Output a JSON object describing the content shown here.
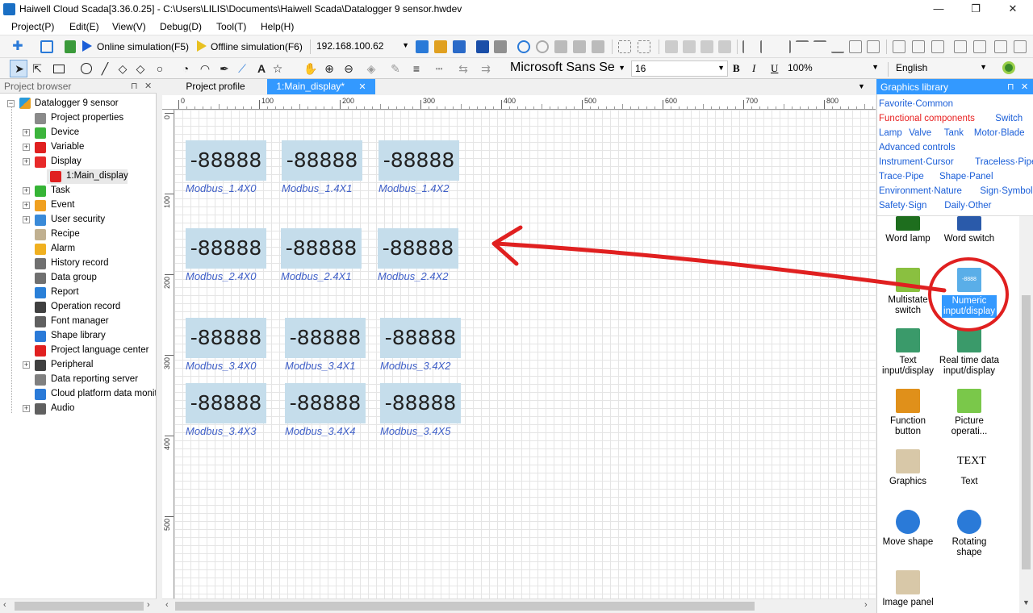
{
  "window": {
    "title": "Haiwell Cloud Scada[3.36.0.25] - C:\\Users\\LILIS\\Documents\\Haiwell Scada\\Datalogger 9 sensor.hwdev",
    "minimize": "—",
    "maximize": "❐",
    "close": "✕"
  },
  "menu": [
    "Project(P)",
    "Edit(E)",
    "View(V)",
    "Debug(D)",
    "Tool(T)",
    "Help(H)"
  ],
  "toolbar": {
    "online_sim": "Online simulation(F5)",
    "offline_sim": "Offline simulation(F6)",
    "ip": "192.168.100.62",
    "font_name": "Microsoft Sans Se",
    "font_size": "16",
    "bold": "B",
    "italic": "I",
    "underline": "U",
    "zoom": "100%",
    "language": "English",
    "text_tool": "A"
  },
  "project_browser": {
    "title": "Project browser",
    "pin": "⊓",
    "close": "✕",
    "root": "Datalogger 9 sensor",
    "items": [
      {
        "label": "Project properties",
        "icon": "properties-icon",
        "color": "#8a8a8a",
        "expandable": false
      },
      {
        "label": "Device",
        "icon": "device-icon",
        "color": "#3cb43c",
        "expandable": true
      },
      {
        "label": "Variable",
        "icon": "variable-icon",
        "color": "#e02020",
        "expandable": true
      },
      {
        "label": "Display",
        "icon": "display-icon",
        "color": "#e82a2a",
        "expandable": true
      },
      {
        "label": "1:Main_display",
        "icon": "star-page-icon",
        "color": "#e02020",
        "expandable": false
      },
      {
        "label": "Task",
        "icon": "task-icon",
        "color": "#36b436",
        "expandable": true
      },
      {
        "label": "Event",
        "icon": "event-icon",
        "color": "#f0a020",
        "expandable": true
      },
      {
        "label": "User security",
        "icon": "user-security-icon",
        "color": "#3a8ad8",
        "expandable": true
      },
      {
        "label": "Recipe",
        "icon": "recipe-icon",
        "color": "#c0b090",
        "expandable": false
      },
      {
        "label": "Alarm",
        "icon": "alarm-icon",
        "color": "#f0b020",
        "expandable": false
      },
      {
        "label": "History record",
        "icon": "history-icon",
        "color": "#707070",
        "expandable": false
      },
      {
        "label": "Data group",
        "icon": "data-group-icon",
        "color": "#707070",
        "expandable": false
      },
      {
        "label": "Report",
        "icon": "report-icon",
        "color": "#2a80d8",
        "expandable": false
      },
      {
        "label": "Operation record",
        "icon": "operation-record-icon",
        "color": "#404040",
        "expandable": false
      },
      {
        "label": "Font manager",
        "icon": "font-manager-icon",
        "color": "#606060",
        "expandable": false
      },
      {
        "label": "Shape library",
        "icon": "shape-library-icon",
        "color": "#2a7ad8",
        "expandable": false
      },
      {
        "label": "Project language center",
        "icon": "language-icon",
        "color": "#e02020",
        "expandable": false
      },
      {
        "label": "Peripheral",
        "icon": "peripheral-icon",
        "color": "#404040",
        "expandable": true
      },
      {
        "label": "Data reporting server",
        "icon": "reporting-server-icon",
        "color": "#808080",
        "expandable": false
      },
      {
        "label": "Cloud platform data monitor",
        "icon": "cloud-icon",
        "color": "#2a7ad8",
        "expandable": false
      },
      {
        "label": "Audio",
        "icon": "audio-icon",
        "color": "#606060",
        "expandable": true
      }
    ]
  },
  "tabs": [
    {
      "label": "Project profile",
      "active": false
    },
    {
      "label": "1:Main_display*",
      "active": true
    }
  ],
  "tab_close": "✕",
  "ruler": {
    "h_ticks": [
      "0",
      "100",
      "200",
      "300",
      "400",
      "500",
      "600",
      "700",
      "800"
    ],
    "v_ticks": [
      "0",
      "100",
      "200",
      "300",
      "400",
      "500"
    ]
  },
  "display_widgets": [
    {
      "value": "-88888",
      "label": "Modbus_1.4X0"
    },
    {
      "value": "-88888",
      "label": "Modbus_1.4X1"
    },
    {
      "value": "-88888",
      "label": "Modbus_1.4X2"
    },
    {
      "value": "-88888",
      "label": "Modbus_2.4X0"
    },
    {
      "value": "-88888",
      "label": "Modbus_2.4X1"
    },
    {
      "value": "-88888",
      "label": "Modbus_2.4X2"
    },
    {
      "value": "-88888",
      "label": "Modbus_3.4X0"
    },
    {
      "value": "-88888",
      "label": "Modbus_3.4X1"
    },
    {
      "value": "-88888",
      "label": "Modbus_3.4X2"
    },
    {
      "value": "-88888",
      "label": "Modbus_3.4X3"
    },
    {
      "value": "-88888",
      "label": "Modbus_3.4X4"
    },
    {
      "value": "-88888",
      "label": "Modbus_3.4X5"
    }
  ],
  "graphics_library": {
    "title": "Graphics library",
    "categories": [
      [
        {
          "label": "Favorite·Common",
          "active": false
        }
      ],
      [
        {
          "label": "Functional components",
          "active": true
        },
        {
          "label": "Switch",
          "active": false
        }
      ],
      [
        {
          "label": "Lamp",
          "active": false
        },
        {
          "label": "Valve",
          "active": false
        },
        {
          "label": "Tank",
          "active": false
        },
        {
          "label": "Motor·Blade",
          "active": false
        }
      ],
      [
        {
          "label": "Advanced controls",
          "active": false
        }
      ],
      [
        {
          "label": "Instrument·Cursor",
          "active": false
        },
        {
          "label": "Traceless·Pipe",
          "active": false
        }
      ],
      [
        {
          "label": "Trace·Pipe",
          "active": false
        },
        {
          "label": "Shape·Panel",
          "active": false
        }
      ],
      [
        {
          "label": "Environment·Nature",
          "active": false
        },
        {
          "label": "Sign·Symbol",
          "active": false
        }
      ],
      [
        {
          "label": "Safety·Sign",
          "active": false
        },
        {
          "label": "Daily·Other",
          "active": false
        }
      ]
    ],
    "items": [
      {
        "label": "Word lamp",
        "icon": "word-lamp-icon",
        "color": "#1e6e1e",
        "selected": false
      },
      {
        "label": "Word switch",
        "icon": "word-switch-icon",
        "color": "#2a5aaa",
        "selected": false
      },
      {
        "label": "Multistate switch",
        "icon": "multistate-switch-icon",
        "color": "#8ac040",
        "selected": false
      },
      {
        "label": "Numeric input/display",
        "icon": "numeric-input-icon",
        "color": "#5aaee8",
        "selected": true
      },
      {
        "label": "Text input/display",
        "icon": "text-input-icon",
        "color": "#3a9a6a",
        "selected": false
      },
      {
        "label": "Real time data input/display",
        "icon": "realtime-data-icon",
        "color": "#3a9a6a",
        "selected": false
      },
      {
        "label": "Function button",
        "icon": "function-button-icon",
        "color": "#e0901a",
        "selected": false
      },
      {
        "label": "Picture operati...",
        "icon": "picture-operation-icon",
        "color": "#7ac84a",
        "selected": false
      },
      {
        "label": "Graphics",
        "icon": "graphics-icon",
        "color": "#d8c8a8",
        "selected": false
      },
      {
        "label": "Text",
        "icon": "text-icon",
        "color": "",
        "selected": false
      },
      {
        "label": "Move shape",
        "icon": "move-shape-icon",
        "color": "#2a7ad8",
        "selected": false
      },
      {
        "label": "Rotating shape",
        "icon": "rotating-shape-icon",
        "color": "#2a7ad8",
        "selected": false
      },
      {
        "label": "Image panel",
        "icon": "image-panel-icon",
        "color": "#d8c8a8",
        "selected": false
      }
    ],
    "text_icon_glyph": "TEXT",
    "selected_icon_glyph": "-8888"
  },
  "colors": {
    "accent": "#3399ff",
    "widget_fill": "#c5ddeb",
    "widget_label": "#4060c8",
    "annotation": "#e02020"
  }
}
